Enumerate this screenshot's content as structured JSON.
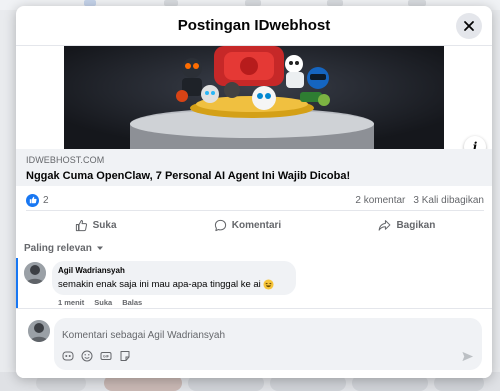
{
  "modal": {
    "title": "Postingan IDwebhost"
  },
  "link_preview": {
    "domain": "IDWEBHOST.COM",
    "title": "Nggak Cuma OpenClaw, 7 Personal AI Agent Ini Wajib Dicoba!"
  },
  "stats": {
    "reactions_count": "2",
    "comments": "2 komentar",
    "shares": "3 Kali dibagikan"
  },
  "actions": {
    "like": "Suka",
    "comment": "Komentari",
    "share": "Bagikan"
  },
  "sort": {
    "label": "Paling relevan"
  },
  "comments": [
    {
      "author": "Agil Wadriansyah",
      "text": "semakin enak saja ini mau apa-apa tinggal ke ai",
      "time": "1 menit",
      "like": "Suka",
      "reply": "Balas"
    }
  ],
  "composer": {
    "placeholder": "Komentari sebagai Agil Wadriansyah"
  },
  "colors": {
    "accent": "#1877f2",
    "bubble": "#f0f2f5",
    "muted_text": "#65676b"
  },
  "icons": [
    "close-icon",
    "info-icon",
    "like-icon",
    "comment-icon",
    "share-icon",
    "chevron-down-icon",
    "avatar-sticker-icon",
    "emoji-icon",
    "gif-icon",
    "sticker-icon",
    "send-icon"
  ]
}
